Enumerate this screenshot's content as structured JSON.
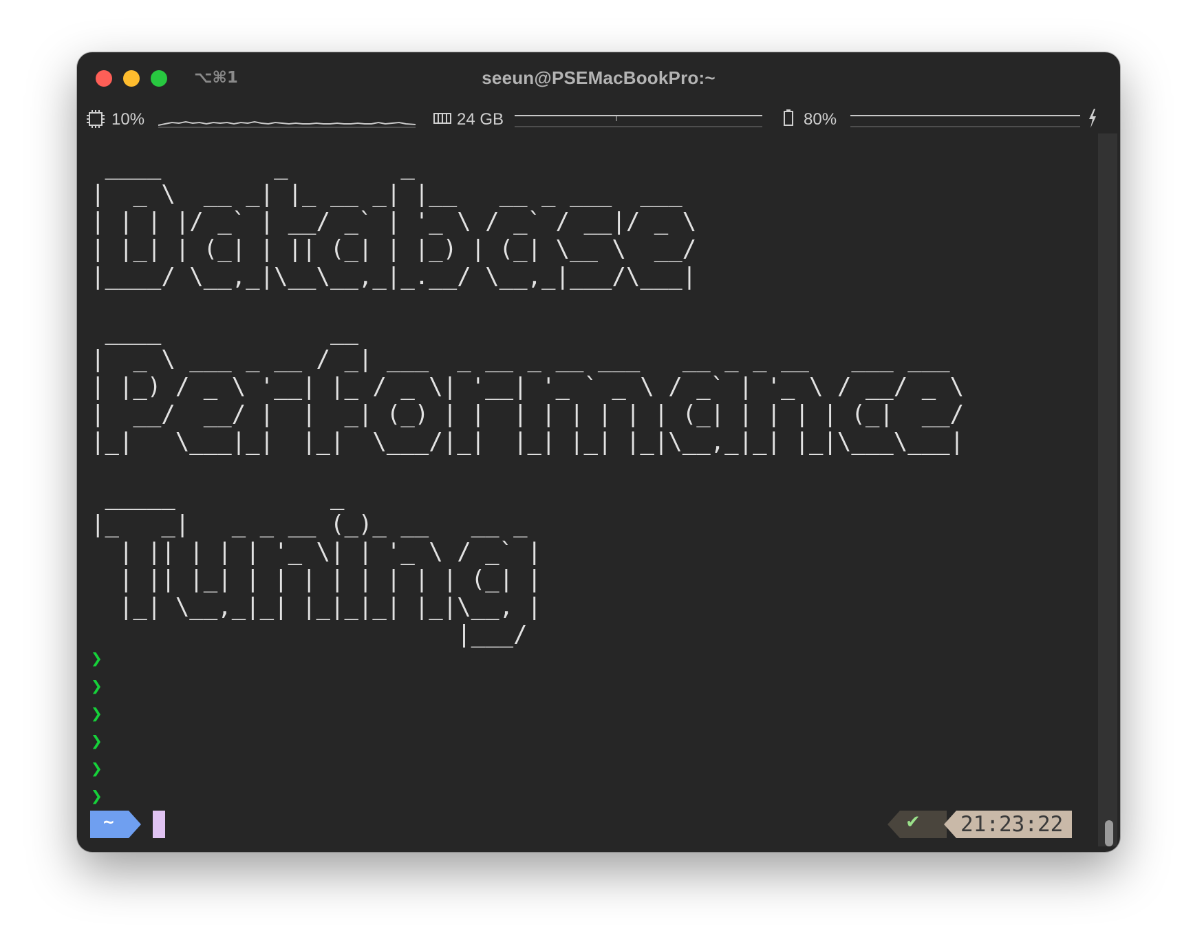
{
  "window": {
    "title": "seeun@PSEMacBookPro:~",
    "shortcut": "⌥⌘1"
  },
  "status": {
    "cpu_label": "10%",
    "cpu_icon": "cpu-chip-icon",
    "memory_label": "24 GB",
    "memory_icon": "memory-icon",
    "battery_label": "80%",
    "battery_icon": "battery-icon",
    "charging_icon": "lightning-bolt-icon"
  },
  "banner": {
    "line1": " ____        _        _\n|  _ \\  __ _| |_ __ _| |__   __ _ ___  ___\n| | | |/ _` | __/ _` | '_ \\ / _` / __|/ _ \\\n| |_| | (_| | || (_| | |_) | (_| \\__ \\  __/\n|____/ \\__,_|\\__\\__,_|_.__/ \\__,_|___/\\___|",
    "line2": " ____            __\n|  _ \\ ___ _ __ / _| ___  _ __ _ __ ___   __ _ _ __   ___ ___\n| |_) / _ \\ '__| |_ / _ \\| '__| '_ ` _ \\ / _` | '_ \\ / __/ _ \\\n|  __/  __/ |  |  _| (_) | |  | | | | | | (_| | | | | (_|  __/\n|_|   \\___|_|  |_|  \\___/|_|  |_| |_| |_|\\__,_|_| |_|\\___\\___|",
    "line3": " _____           _\n|_   _|   _ _ __ (_)_ __   __ _\n  | || | | | '_ \\| | '_ \\ / _` |\n  | || |_| | | | | | | | | (_| |\n  |_| \\__,_|_| |_|_|_| |_|\\__, |\n                          |___/"
  },
  "prompts": [
    "❯",
    "❯",
    "❯",
    "❯",
    "❯",
    "❯"
  ],
  "prompt_bar": {
    "directory": "~",
    "status_check": "✔",
    "time": "21:23:22",
    "dir_color": "#6f9ff0",
    "time_bg": "#c9b9a8",
    "status_bg": "#4a453d"
  }
}
